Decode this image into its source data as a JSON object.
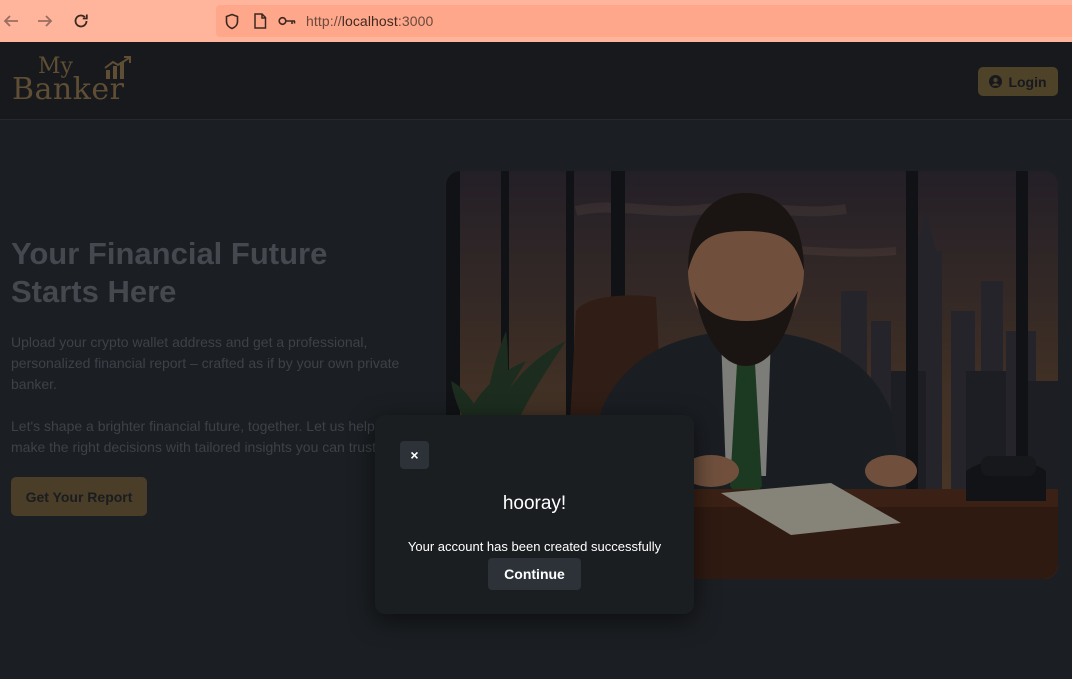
{
  "browser": {
    "url_scheme": "http://",
    "url_host": "localhost",
    "url_port": ":3000",
    "icons": [
      "back-arrow-icon",
      "forward-arrow-icon",
      "reload-icon",
      "shield-icon",
      "page-icon",
      "key-icon"
    ]
  },
  "header": {
    "logo_top": "My",
    "logo_bottom": "Banker",
    "login_label": "Login"
  },
  "hero": {
    "title": "Your Financial Future Starts Here",
    "paragraph1": "Upload your crypto wallet address and get a professional, personalized financial report – crafted as if by your own private banker.",
    "paragraph2": "Let's shape a brighter financial future, together. Let us help you make the right decisions with tailored insights you can trust.",
    "cta_label": "Get Your Report"
  },
  "modal": {
    "close_label": "×",
    "title": "hooray!",
    "message": "Your account has been created successfully",
    "continue_label": "Continue"
  },
  "colors": {
    "browser_bar": "#ffb49c",
    "page_bg": "#1b1e22",
    "accent_gold": "#5f4e33",
    "modal_bg": "#1b1e21",
    "button_dark": "#2d3239"
  }
}
